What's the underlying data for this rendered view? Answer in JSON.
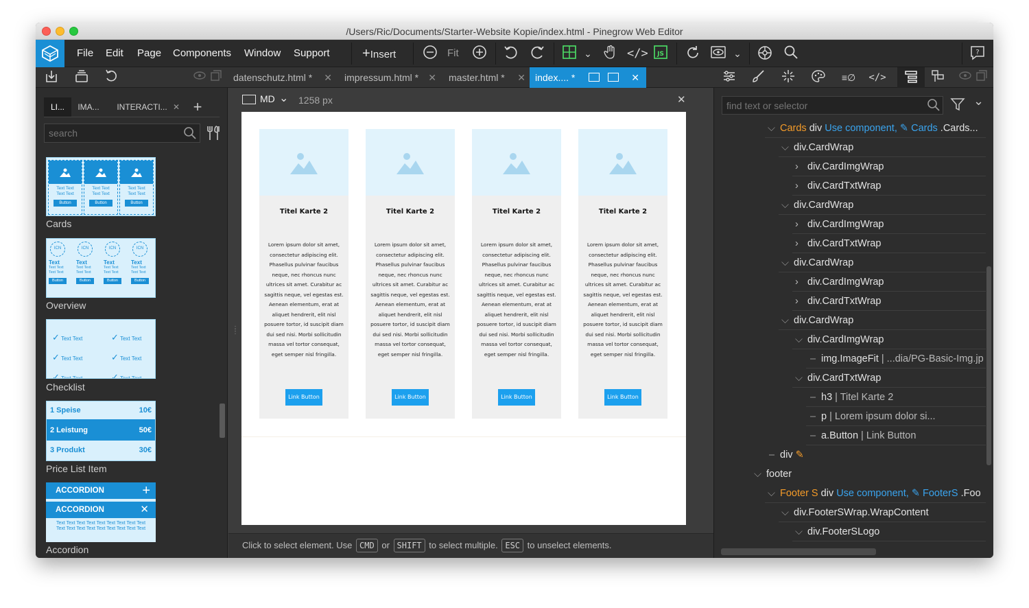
{
  "window": {
    "title": "/Users/Ric/Documents/Starter-Website Kopie/index.html - Pinegrow Web Editor"
  },
  "menu": [
    "File",
    "Edit",
    "Page",
    "Components",
    "Window",
    "Support"
  ],
  "toolbar": {
    "insert_label": "Insert",
    "fit_label": "Fit"
  },
  "file_tabs": [
    {
      "label": "datenschutz.html *"
    },
    {
      "label": "impressum.html *"
    },
    {
      "label": "master.html *"
    },
    {
      "label": "index.... *"
    }
  ],
  "library": {
    "tabs": [
      "LI...",
      "IMA...",
      "INTERACTI..."
    ],
    "search_placeholder": "search",
    "items": [
      {
        "label": "Cards"
      },
      {
        "label": "Overview"
      },
      {
        "label": "Checklist"
      },
      {
        "label": "Price List Item"
      },
      {
        "label": "Accordion"
      }
    ],
    "thumb_cards": {
      "text1": "Text Text",
      "text2": "Text Text",
      "button": "Button"
    },
    "thumb_overview": {
      "icon": "ICN",
      "heading": "Text",
      "text": "Text Text",
      "button": "Button"
    },
    "thumb_checklist": {
      "text": "Text Text"
    },
    "thumb_price": [
      {
        "label": "1  Speise",
        "price": "10€"
      },
      {
        "label": "2  Leistung",
        "price": "50€"
      },
      {
        "label": "3  Produkt",
        "price": "30€"
      }
    ],
    "thumb_accordion": {
      "header": "ACCORDION",
      "body": "Text Text Text Text Text Text Text Text Text Text Text Text Text Text Text Text Text Text"
    }
  },
  "canvas": {
    "device": "MD",
    "width_label": "1258 px",
    "cards": [
      {
        "title": "Titel Karte 2",
        "text": "Lorem ipsum dolor sit amet, consectetur adipiscing elit. Phasellus pulvinar faucibus neque, nec rhoncus nunc ultrices sit amet. Curabitur ac sagittis neque, vel egestas est. Aenean elementum, erat at aliquet hendrerit, elit nisl posuere tortor, id suscipit diam dui sed nisi. Morbi sollicitudin massa vel tortor consequat, eget semper nisl fringilla.",
        "button": "Link Button"
      },
      {
        "title": "Titel Karte 2",
        "text": "Lorem ipsum dolor sit amet, consectetur adipiscing elit. Phasellus pulvinar faucibus neque, nec rhoncus nunc ultrices sit amet. Curabitur ac sagittis neque, vel egestas est. Aenean elementum, erat at aliquet hendrerit, elit nisl posuere tortor, id suscipit diam dui sed nisi. Morbi sollicitudin massa vel tortor consequat, eget semper nisl fringilla.",
        "button": "Link Button"
      },
      {
        "title": "Titel Karte 2",
        "text": "Lorem ipsum dolor sit amet, consectetur adipiscing elit. Phasellus pulvinar faucibus neque, nec rhoncus nunc ultrices sit amet. Curabitur ac sagittis neque, vel egestas est. Aenean elementum, erat at aliquet hendrerit, elit nisl posuere tortor, id suscipit diam dui sed nisi. Morbi sollicitudin massa vel tortor consequat, eget semper nisl fringilla.",
        "button": "Link Button"
      },
      {
        "title": "Titel Karte 2",
        "text": "Lorem ipsum dolor sit amet, consectetur adipiscing elit. Phasellus pulvinar faucibus neque, nec rhoncus nunc ultrices sit amet. Curabitur ac sagittis neque, vel egestas est. Aenean elementum, erat at aliquet hendrerit, elit nisl posuere tortor, id suscipit diam dui sed nisi. Morbi sollicitudin massa vel tortor consequat, eget semper nisl fringilla.",
        "button": "Link Button"
      }
    ]
  },
  "status": {
    "part1": "Click to select element. Use",
    "key1": "CMD",
    "part2": "or",
    "key2": "SHIFT",
    "part3": "to select multiple.",
    "key3": "ESC",
    "part4": "to unselect elements."
  },
  "tree": {
    "search_placeholder": "find text or selector",
    "rows": [
      {
        "prefix": "Cards",
        "text": " div ",
        "extra": "Use component, ",
        "comp": "Cards",
        "tail": " .Cards..."
      },
      {
        "text": "div.CardWrap"
      },
      {
        "text": "div.CardImgWrap"
      },
      {
        "text": "div.CardTxtWrap"
      },
      {
        "text": "div.CardWrap"
      },
      {
        "text": "div.CardImgWrap"
      },
      {
        "text": "div.CardTxtWrap"
      },
      {
        "text": "div.CardWrap"
      },
      {
        "text": "div.CardImgWrap"
      },
      {
        "text": "div.CardTxtWrap"
      },
      {
        "text": "div.CardWrap"
      },
      {
        "text": "div.CardImgWrap"
      },
      {
        "text": "img.ImageFit",
        "tail": " | ...dia/PG-Basic-Img.jp"
      },
      {
        "text": "div.CardTxtWrap"
      },
      {
        "text": "h3",
        "tail": " | Titel Karte 2"
      },
      {
        "text": "p",
        "tail": " | Lorem ipsum dolor si..."
      },
      {
        "text": "a.Button",
        "tail": " | Link Button"
      },
      {
        "text": "div"
      },
      {
        "text": "footer"
      },
      {
        "prefix": "Footer S",
        "text": " div ",
        "extra": "Use component, ",
        "comp": "FooterS",
        "tail": " .Foo"
      },
      {
        "text": "div.FooterSWrap.WrapContent"
      },
      {
        "text": "div.FooterSLogo"
      }
    ]
  },
  "colors": {
    "accent": "#1a8fd5",
    "orange": "#f49b29",
    "link_blue": "#3aa4ee"
  }
}
